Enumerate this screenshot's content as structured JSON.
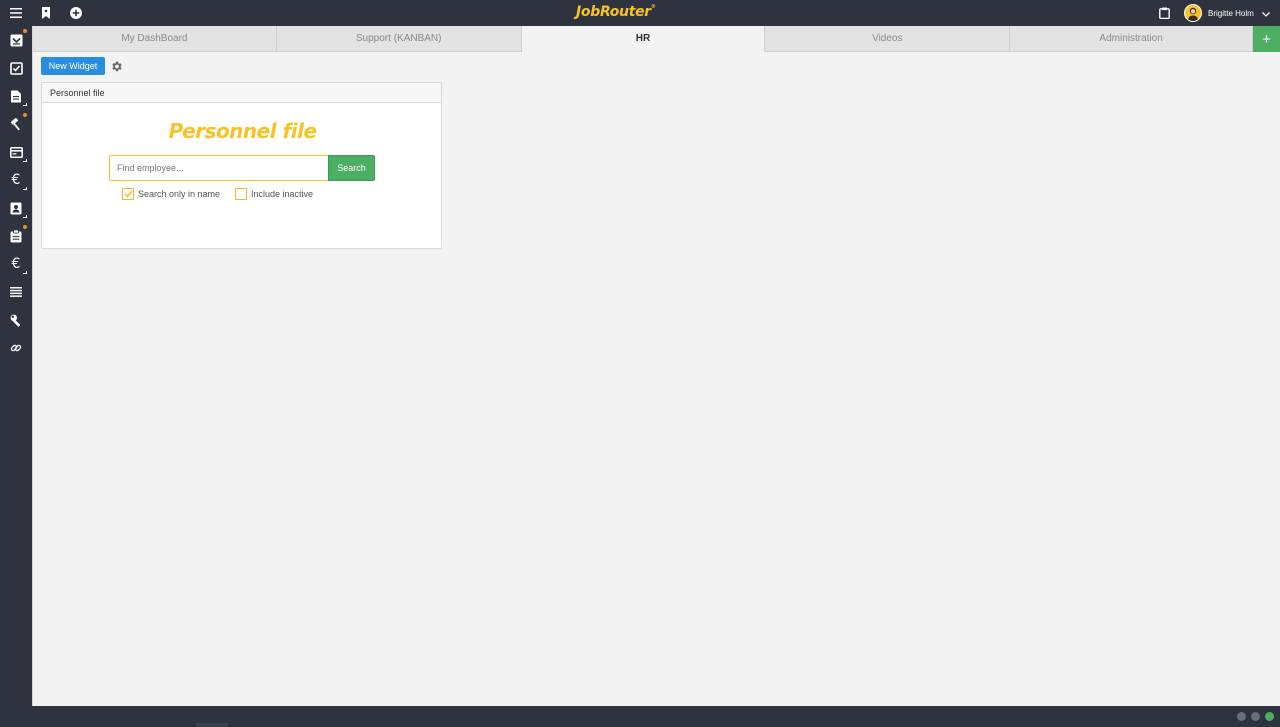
{
  "app": {
    "logo": "JobRouter",
    "logo_mark": "®"
  },
  "topbar": {
    "icons": [
      "menu-icon",
      "bookmark-icon",
      "add-circle-icon",
      "clipboard-icon"
    ],
    "user": {
      "name": "Brigitte Holm"
    }
  },
  "sidebar": {
    "items": [
      {
        "icon": "inbox-icon",
        "badge": true
      },
      {
        "icon": "completed-tasks-icon",
        "badge": false
      },
      {
        "icon": "document-icon",
        "badge": false
      },
      {
        "icon": "hammer-icon",
        "badge": true
      },
      {
        "icon": "card-icon",
        "badge": false
      },
      {
        "icon": "euro-icon",
        "badge": false
      },
      {
        "icon": "contact-icon",
        "badge": false
      },
      {
        "icon": "clipboard-list-icon",
        "badge": true
      },
      {
        "icon": "euro-icon",
        "badge": false
      },
      {
        "icon": "list-icon",
        "badge": false
      },
      {
        "icon": "wrench-icon",
        "badge": false
      },
      {
        "icon": "link-icon",
        "badge": false
      }
    ]
  },
  "tabs": [
    {
      "label": "My DashBoard",
      "active": false
    },
    {
      "label": "Support (KANBAN)",
      "active": false
    },
    {
      "label": "HR",
      "active": true
    },
    {
      "label": "Videos",
      "active": false
    },
    {
      "label": "Administration",
      "active": false
    }
  ],
  "tab_add_label": "+",
  "toolbar": {
    "new_widget_label": "New Widget"
  },
  "widget": {
    "header": "Personnel file",
    "title": "Personnel file",
    "search_placeholder": "Find employee...",
    "search_value": "",
    "search_button": "Search",
    "checkboxes": [
      {
        "label": "Search only in name",
        "checked": true
      },
      {
        "label": "Include inactive",
        "checked": false
      }
    ]
  },
  "status_dots": [
    {
      "color": "#6b6f78"
    },
    {
      "color": "#6b6f78"
    },
    {
      "color": "#4caf63"
    }
  ],
  "colors": {
    "brand": "#f7c325",
    "accent_blue": "#2a8ee0",
    "accent_green": "#4caf63",
    "chrome": "#2e333f",
    "badge": "#f08a24"
  }
}
